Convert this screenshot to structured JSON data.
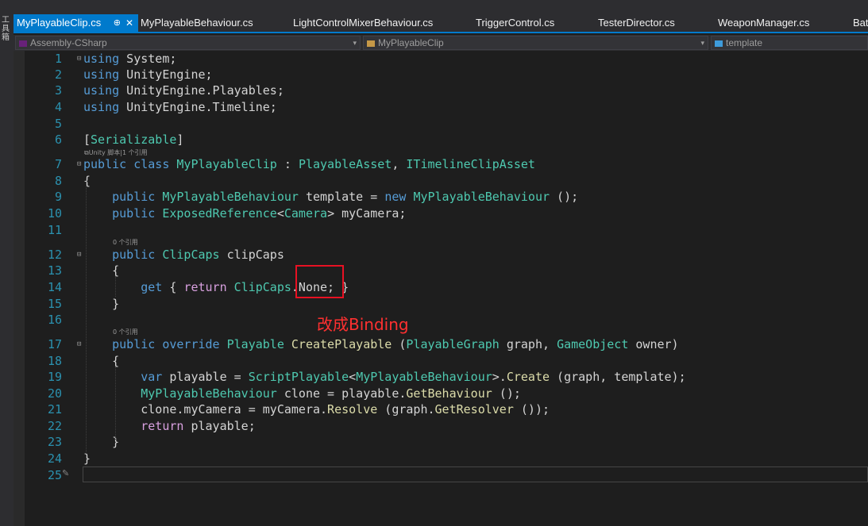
{
  "side_panel": {
    "label": "工具箱"
  },
  "tabs": [
    {
      "label": "MyPlayableClip.cs",
      "active": true
    },
    {
      "label": "MyPlayableBehaviour.cs"
    },
    {
      "label": "LightControlMixerBehaviour.cs"
    },
    {
      "label": "TriggerControl.cs"
    },
    {
      "label": "TesterDirector.cs"
    },
    {
      "label": "WeaponManager.cs"
    },
    {
      "label": "Bat"
    }
  ],
  "navbar": {
    "project": "Assembly-CSharp",
    "class": "MyPlayableClip",
    "member": "template"
  },
  "codelens": {
    "line7": "⧉Unity 脚本|1 个引用",
    "line12": "0 个引用",
    "line17": "0 个引用"
  },
  "annotation": {
    "text": "改成Binding",
    "color": "#ff3030"
  },
  "code_lines": [
    {
      "n": "1",
      "fold": "⊟",
      "tokens": [
        {
          "t": "using",
          "c": "kw"
        },
        {
          "t": " System;",
          "c": "pl"
        }
      ]
    },
    {
      "n": "2",
      "fold": "",
      "tokens": [
        {
          "t": "using",
          "c": "kw"
        },
        {
          "t": " UnityEngine;",
          "c": "pl"
        }
      ]
    },
    {
      "n": "3",
      "fold": "",
      "tokens": [
        {
          "t": "using",
          "c": "kw"
        },
        {
          "t": " UnityEngine.Playables;",
          "c": "pl"
        }
      ]
    },
    {
      "n": "4",
      "fold": "",
      "tokens": [
        {
          "t": "using",
          "c": "kw"
        },
        {
          "t": " UnityEngine.Timeline;",
          "c": "pl"
        }
      ]
    },
    {
      "n": "5",
      "fold": "",
      "tokens": []
    },
    {
      "n": "6",
      "fold": "",
      "tokens": [
        {
          "t": "[",
          "c": "pl"
        },
        {
          "t": "Serializable",
          "c": "tp"
        },
        {
          "t": "]",
          "c": "pl"
        }
      ]
    },
    {
      "n": "7",
      "fold": "⊟",
      "tokens": [
        {
          "t": "public class ",
          "c": "kw"
        },
        {
          "t": "MyPlayableClip",
          "c": "tp"
        },
        {
          "t": " : ",
          "c": "pl"
        },
        {
          "t": "PlayableAsset",
          "c": "tp"
        },
        {
          "t": ", ",
          "c": "pl"
        },
        {
          "t": "ITimelineClipAsset",
          "c": "tp"
        }
      ]
    },
    {
      "n": "8",
      "fold": "",
      "tokens": [
        {
          "t": "{",
          "c": "pl"
        }
      ]
    },
    {
      "n": "9",
      "fold": "",
      "tokens": [
        {
          "t": "    public ",
          "c": "kw"
        },
        {
          "t": "MyPlayableBehaviour",
          "c": "tp"
        },
        {
          "t": " template = ",
          "c": "pl"
        },
        {
          "t": "new ",
          "c": "kw"
        },
        {
          "t": "MyPlayableBehaviour",
          "c": "tp"
        },
        {
          "t": " ();",
          "c": "pl"
        }
      ]
    },
    {
      "n": "10",
      "fold": "",
      "tokens": [
        {
          "t": "    public ",
          "c": "kw"
        },
        {
          "t": "ExposedReference",
          "c": "tp"
        },
        {
          "t": "<",
          "c": "pl"
        },
        {
          "t": "Camera",
          "c": "tp"
        },
        {
          "t": "> myCamera;",
          "c": "pl"
        }
      ]
    },
    {
      "n": "11",
      "fold": "",
      "tokens": []
    },
    {
      "n": "12",
      "fold": "⊟",
      "tokens": [
        {
          "t": "    public ",
          "c": "kw"
        },
        {
          "t": "ClipCaps",
          "c": "tp"
        },
        {
          "t": " clipCaps",
          "c": "pl"
        }
      ]
    },
    {
      "n": "13",
      "fold": "",
      "tokens": [
        {
          "t": "    {",
          "c": "pl"
        }
      ]
    },
    {
      "n": "14",
      "fold": "",
      "tokens": [
        {
          "t": "        get",
          "c": "kw"
        },
        {
          "t": " { ",
          "c": "pl"
        },
        {
          "t": "return ",
          "c": "ct"
        },
        {
          "t": "ClipCaps",
          "c": "tp"
        },
        {
          "t": ".None; }",
          "c": "pl"
        }
      ]
    },
    {
      "n": "15",
      "fold": "",
      "tokens": [
        {
          "t": "    }",
          "c": "pl"
        }
      ]
    },
    {
      "n": "16",
      "fold": "",
      "tokens": []
    },
    {
      "n": "17",
      "fold": "⊟",
      "tokens": [
        {
          "t": "    public override ",
          "c": "kw"
        },
        {
          "t": "Playable",
          "c": "tp"
        },
        {
          "t": " ",
          "c": "pl"
        },
        {
          "t": "CreatePlayable",
          "c": "fn"
        },
        {
          "t": " (",
          "c": "pl"
        },
        {
          "t": "PlayableGraph",
          "c": "tp"
        },
        {
          "t": " graph, ",
          "c": "pl"
        },
        {
          "t": "GameObject",
          "c": "tp"
        },
        {
          "t": " owner)",
          "c": "pl"
        }
      ]
    },
    {
      "n": "18",
      "fold": "",
      "tokens": [
        {
          "t": "    {",
          "c": "pl"
        }
      ]
    },
    {
      "n": "19",
      "fold": "",
      "tokens": [
        {
          "t": "        var ",
          "c": "kw"
        },
        {
          "t": "playable = ",
          "c": "pl"
        },
        {
          "t": "ScriptPlayable",
          "c": "tp"
        },
        {
          "t": "<",
          "c": "pl"
        },
        {
          "t": "MyPlayableBehaviour",
          "c": "tp"
        },
        {
          "t": ">.",
          "c": "pl"
        },
        {
          "t": "Create",
          "c": "fn"
        },
        {
          "t": " (graph, template);",
          "c": "pl"
        }
      ]
    },
    {
      "n": "20",
      "fold": "",
      "tokens": [
        {
          "t": "        ",
          "c": "pl"
        },
        {
          "t": "MyPlayableBehaviour",
          "c": "tp"
        },
        {
          "t": " clone = playable.",
          "c": "pl"
        },
        {
          "t": "GetBehaviour",
          "c": "fn"
        },
        {
          "t": " ();",
          "c": "pl"
        }
      ]
    },
    {
      "n": "21",
      "fold": "",
      "tokens": [
        {
          "t": "        clone.myCamera = myCamera.",
          "c": "pl"
        },
        {
          "t": "Resolve",
          "c": "fn"
        },
        {
          "t": " (graph.",
          "c": "pl"
        },
        {
          "t": "GetResolver",
          "c": "fn"
        },
        {
          "t": " ());",
          "c": "pl"
        }
      ]
    },
    {
      "n": "22",
      "fold": "",
      "tokens": [
        {
          "t": "        ",
          "c": "pl"
        },
        {
          "t": "return ",
          "c": "ct"
        },
        {
          "t": "playable;",
          "c": "pl"
        }
      ]
    },
    {
      "n": "23",
      "fold": "",
      "tokens": [
        {
          "t": "    }",
          "c": "pl"
        }
      ]
    },
    {
      "n": "24",
      "fold": "",
      "tokens": [
        {
          "t": "}",
          "c": "pl"
        }
      ]
    },
    {
      "n": "25",
      "fold": "",
      "tokens": []
    }
  ]
}
